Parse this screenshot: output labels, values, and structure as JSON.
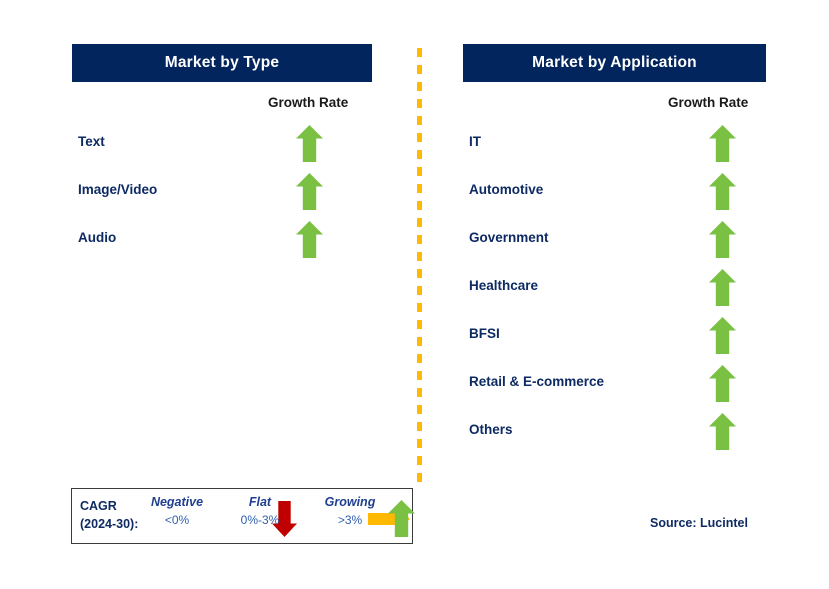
{
  "colors": {
    "header_navy": "#03255e",
    "label_navy": "#0d2a63",
    "growth_green": "#7ac143",
    "negative_red": "#c00000",
    "flat_orange": "#ffb900",
    "divider_orange": "#ffb900"
  },
  "panels": [
    {
      "id": "market-by-type",
      "title": "Market by Type",
      "growth_rate_label": "Growth Rate",
      "rows": [
        {
          "label": "Text",
          "trend": "growing",
          "icon": "arrow-up-icon"
        },
        {
          "label": "Image/Video",
          "trend": "growing",
          "icon": "arrow-up-icon"
        },
        {
          "label": "Audio",
          "trend": "growing",
          "icon": "arrow-up-icon"
        }
      ]
    },
    {
      "id": "market-by-application",
      "title": "Market by Application",
      "growth_rate_label": "Growth Rate",
      "rows": [
        {
          "label": "IT",
          "trend": "growing",
          "icon": "arrow-up-icon"
        },
        {
          "label": "Automotive",
          "trend": "growing",
          "icon": "arrow-up-icon"
        },
        {
          "label": "Government",
          "trend": "growing",
          "icon": "arrow-up-icon"
        },
        {
          "label": "Healthcare",
          "trend": "growing",
          "icon": "arrow-up-icon"
        },
        {
          "label": "BFSI",
          "trend": "growing",
          "icon": "arrow-up-icon"
        },
        {
          "label": "Retail & E-commerce",
          "trend": "growing",
          "icon": "arrow-up-icon"
        },
        {
          "label": "Others",
          "trend": "growing",
          "icon": "arrow-up-icon"
        }
      ]
    }
  ],
  "legend": {
    "title_line1": "CAGR",
    "title_line2": "(2024-30):",
    "items": [
      {
        "term": "Negative",
        "range": "<0%",
        "icon": "arrow-down-icon",
        "color": "#c00000"
      },
      {
        "term": "Flat",
        "range": "0%-3%",
        "icon": "arrow-right-icon",
        "color": "#ffb900"
      },
      {
        "term": "Growing",
        "range": ">3%",
        "icon": "arrow-up-icon",
        "color": "#7ac143"
      }
    ]
  },
  "source": "Source: Lucintel"
}
